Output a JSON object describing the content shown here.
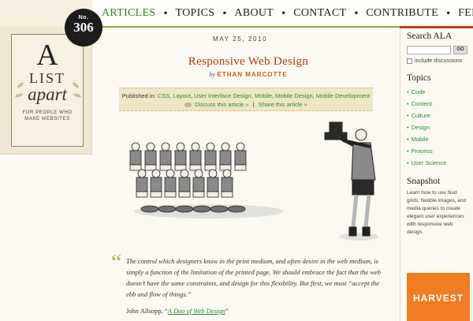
{
  "nav": {
    "items": [
      "ARTICLES",
      "TOPICS",
      "ABOUT",
      "CONTACT",
      "CONTRIBUTE",
      "FEED"
    ],
    "active": "ARTICLES",
    "accent": "#2f7f25"
  },
  "logo": {
    "badge_no": "No.",
    "issue": "306",
    "letter_a": "A",
    "list": "LIST",
    "apart": "apart",
    "tagline_1": "FOR PEOPLE WHO",
    "tagline_2": "MAKE WEBSITES"
  },
  "article": {
    "date": "MAY 25, 2010",
    "title": "Responsive Web Design",
    "by": "by",
    "author": "ETHAN MARCOTTE",
    "published_label": "Published in:",
    "categories": [
      "CSS",
      "Layout",
      "User Interface Design",
      "Mobile",
      "Mobile Design",
      "Mobile Development"
    ],
    "discuss": "Discuss this article »",
    "share": "Share this article »",
    "quote": "The control which designers know in the print medium, and often desire in the web medium, is simply a function of the limitation of the printed page. We should embrace the fact that the web doesn’t have the same constraints, and design for this flexibility. But first, we must “accept the ebb and flow of things.”",
    "cite_author": "John Allsopp, ",
    "cite_open": "“",
    "cite_book": "A Dao of Web Design",
    "cite_close": "”",
    "title_color": "#b23b1b"
  },
  "sidebar": {
    "search_title": "Search ALA",
    "search_value": "",
    "go_label": "GO",
    "include_label": "include discussions",
    "topics_title": "Topics",
    "topics": [
      "Code",
      "Content",
      "Culture",
      "Design",
      "Mobile",
      "Process",
      "User Science"
    ],
    "snapshot_title": "Snapshot",
    "snapshot_text": "Learn how to use fluid grids, flexible images, and media queries to create elegant user experiences with responsive web design.",
    "ad_label": "HARVEST",
    "ad_color": "#f07c23"
  }
}
